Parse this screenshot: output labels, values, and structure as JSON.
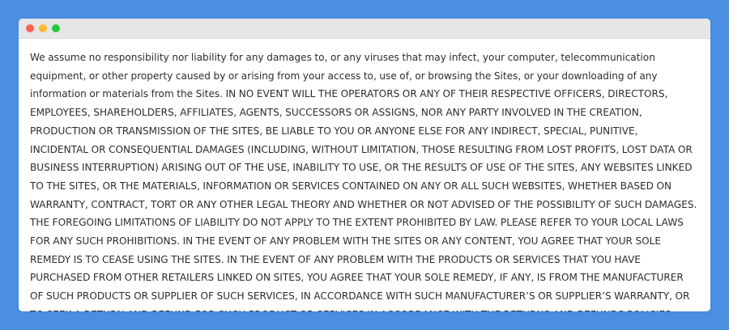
{
  "window": {
    "controls": [
      "close",
      "minimize",
      "maximize"
    ],
    "colors": {
      "background": "#4a8fe2",
      "close": "#fe5f57",
      "minimize": "#febc2e",
      "maximize": "#28c840"
    }
  },
  "document": {
    "text": "We assume no responsibility nor liability for any damages to, or any viruses that may infect, your computer, telecommunication equipment, or other property caused by or arising from your access to, use of, or browsing the Sites, or your downloading of any information or materials from the Sites. IN NO EVENT WILL THE OPERATORS OR ANY OF THEIR RESPECTIVE OFFICERS, DIRECTORS, EMPLOYEES, SHAREHOLDERS, AFFILIATES, AGENTS, SUCCESSORS OR ASSIGNS, NOR ANY PARTY INVOLVED IN THE CREATION, PRODUCTION OR TRANSMISSION OF THE SITES, BE LIABLE TO YOU OR ANYONE ELSE FOR ANY INDIRECT, SPECIAL, PUNITIVE, INCIDENTAL OR CONSEQUENTIAL DAMAGES (INCLUDING, WITHOUT LIMITATION, THOSE RESULTING FROM LOST PROFITS, LOST DATA OR BUSINESS INTERRUPTION) ARISING OUT OF THE USE, INABILITY TO USE, OR THE RESULTS OF USE OF THE SITES, ANY WEBSITES LINKED TO THE SITES, OR THE MATERIALS, INFORMATION OR SERVICES CONTAINED ON ANY OR ALL SUCH WEBSITES, WHETHER BASED ON WARRANTY, CONTRACT, TORT OR ANY OTHER LEGAL THEORY AND WHETHER OR NOT ADVISED OF THE POSSIBILITY OF SUCH DAMAGES. THE FOREGOING LIMITATIONS OF LIABILITY DO NOT APPLY TO THE EXTENT PROHIBITED BY LAW. PLEASE REFER TO YOUR LOCAL LAWS FOR ANY SUCH PROHIBITIONS. IN THE EVENT OF ANY PROBLEM WITH THE SITES OR ANY CONTENT, YOU AGREE THAT YOUR SOLE REMEDY IS TO CEASE USING THE SITES. IN THE EVENT OF ANY PROBLEM WITH THE PRODUCTS OR SERVICES THAT YOU HAVE PURCHASED FROM OTHER RETAILERS LINKED ON SITES, YOU AGREE THAT YOUR SOLE REMEDY, IF ANY, IS FROM THE MANUFACTURER OF SUCH PRODUCTS OR SUPPLIER OF SUCH SERVICES, IN ACCORDANCE WITH SUCH MANUFACTURER’S OR SUPPLIER’S WARRANTY, OR TO SEEK A RETURN AND REFUND FOR SUCH PRODUCT OR SERVICES IN ACCORDANCE WITH THE RETURNS AND REFUNDS POLICIES POSTED ON THE SITES."
  }
}
